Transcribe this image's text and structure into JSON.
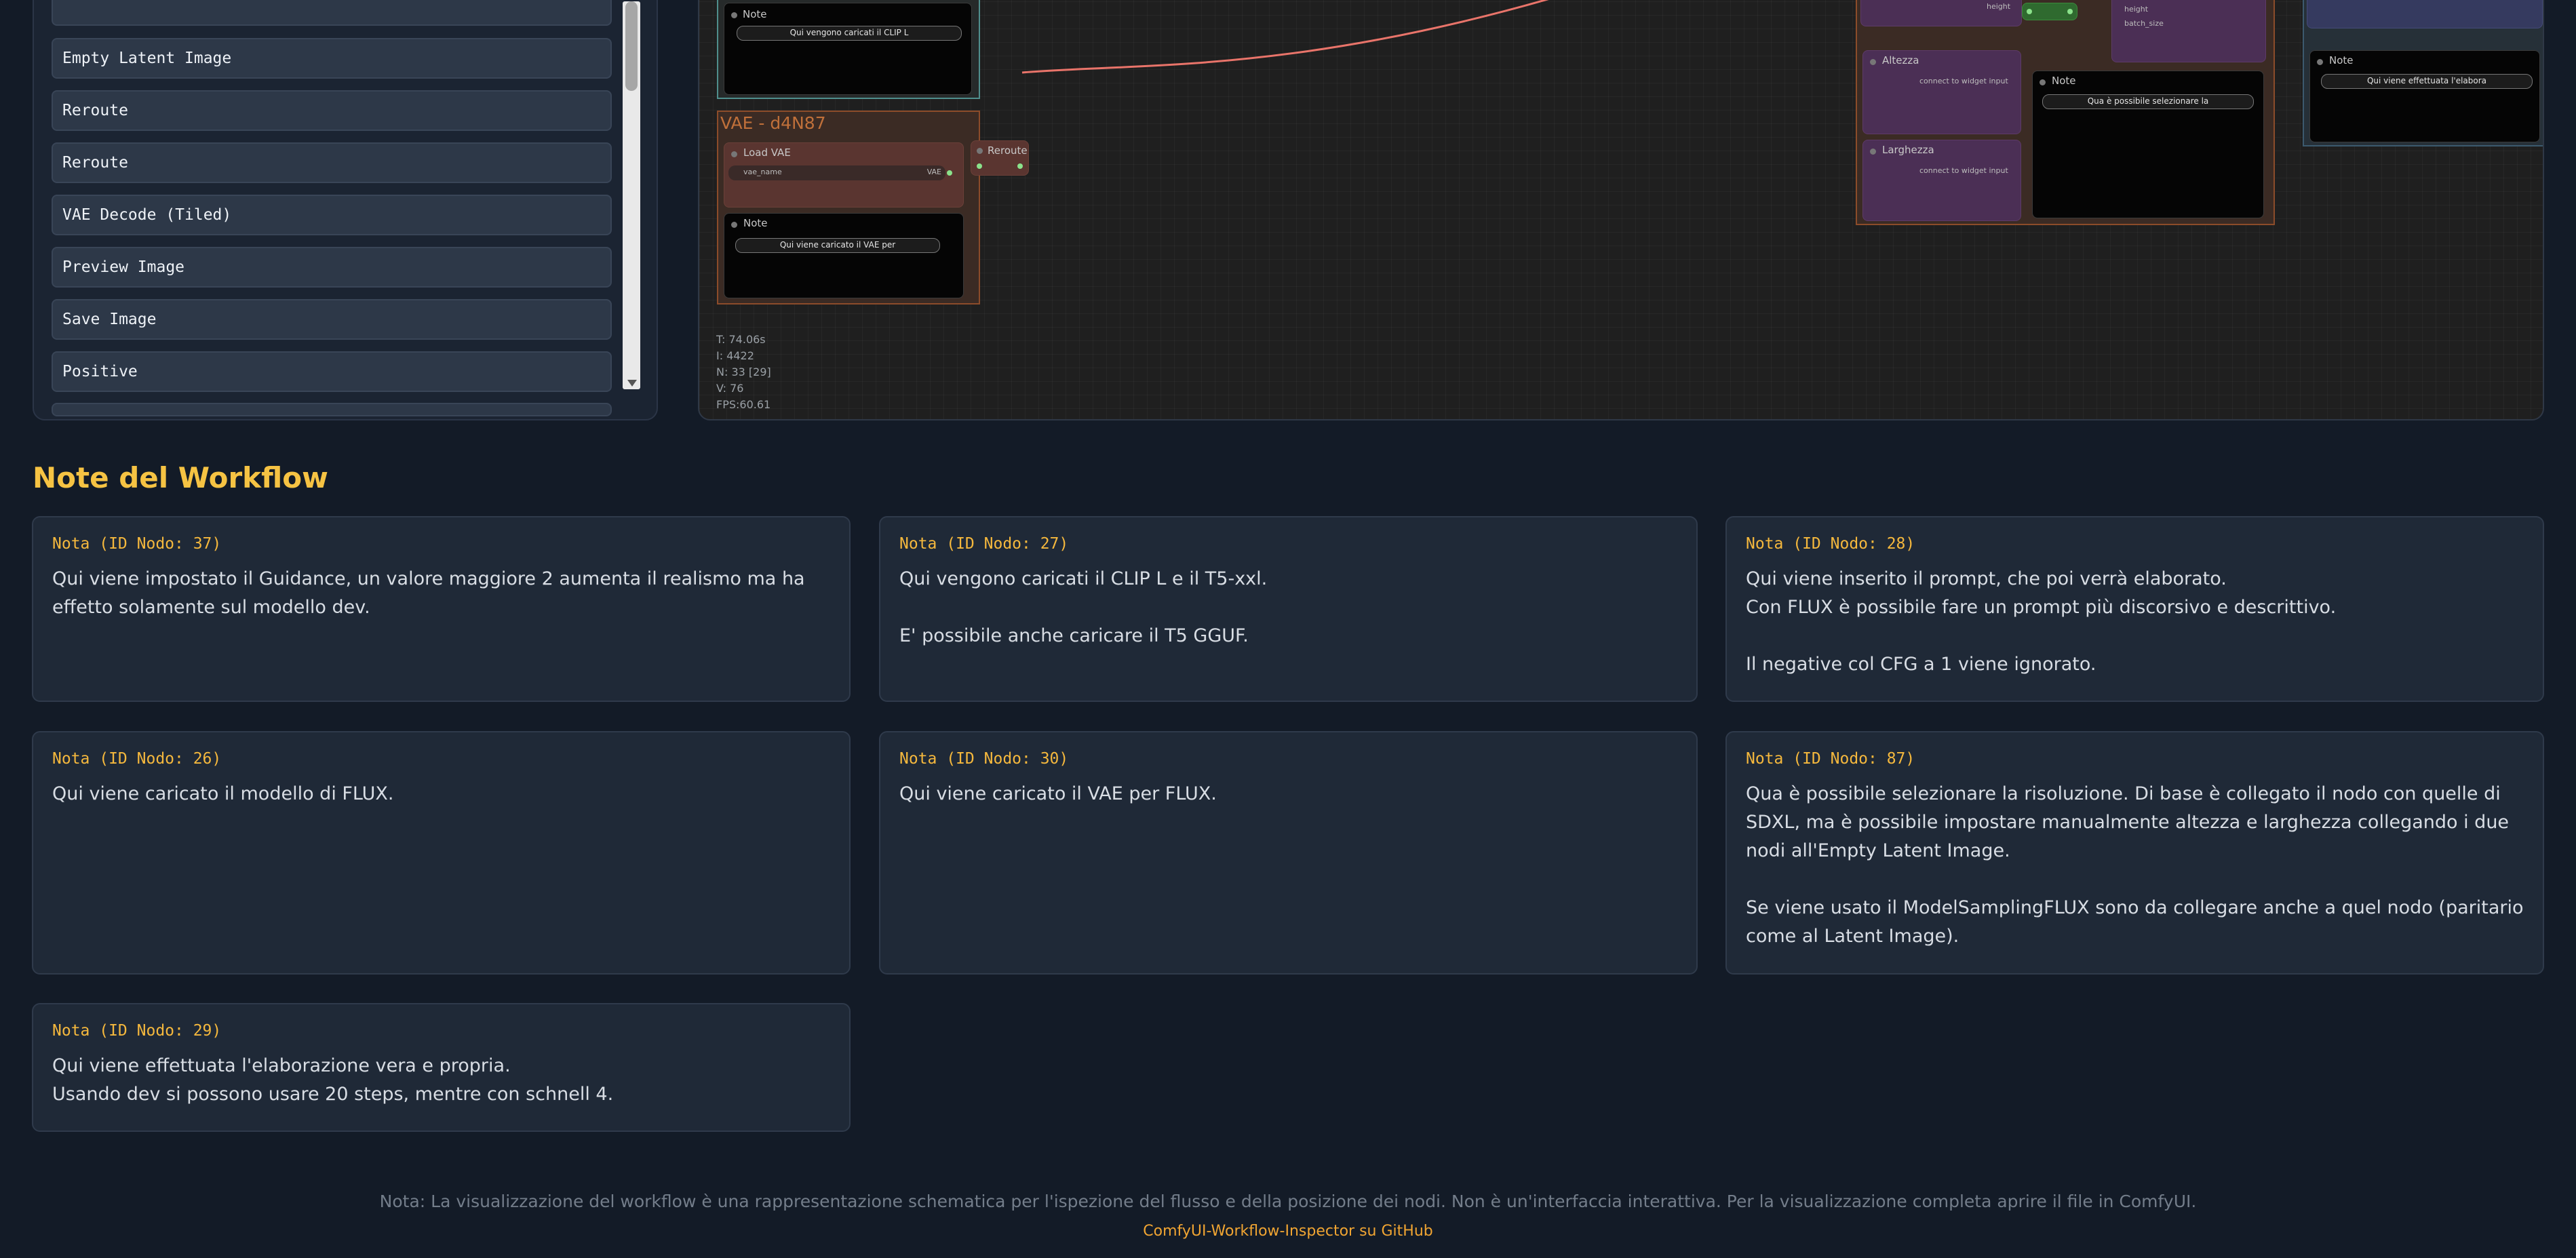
{
  "node_list": {
    "items": [
      "Empty Latent Image",
      "Reroute",
      "Reroute",
      "VAE Decode (Tiled)",
      "Preview Image",
      "Save Image",
      "Positive"
    ]
  },
  "canvas": {
    "vae_group_title": "VAE - d4N87",
    "load_vae_title": "Load VAE",
    "vae_name_label": "vae_name",
    "vae_output_label": "VAE",
    "reroute_title": "Reroute",
    "note_title": "Note",
    "note_clip_preview": "Qui vengono caricati il CLIP L",
    "note_vae_preview": "Qui viene caricato il VAE per",
    "altezza_title": "Altezza",
    "larghezza_title": "Larghezza",
    "connect_widget_label": "connect to widget input",
    "resolution_note_preview": "Qua è possibile selezionare la",
    "right_note_preview": "Qui viene effettuata l'elabora",
    "height_label": "height",
    "batch_size_label": "batch_size",
    "stats": {
      "t": "T: 74.06s",
      "i": "I: 4422",
      "n": "N: 33 [29]",
      "v": "V: 76",
      "fps": "FPS:60.61"
    },
    "colors": {
      "link": "#e9746a",
      "vae_group": "#8c4c2a",
      "purple_node": "#4b2f55",
      "blue_group": "#353a5f"
    }
  },
  "notes": {
    "heading": "Note del Workflow",
    "cards": [
      {
        "id": "Nota (ID Nodo: 37)",
        "text": "Qui viene impostato il Guidance, un valore maggiore 2 aumenta il realismo ma ha effetto solamente sul modello dev."
      },
      {
        "id": "Nota (ID Nodo: 27)",
        "text": "Qui vengono caricati il CLIP L e il T5-xxl.\n\nE' possibile anche caricare il T5 GGUF."
      },
      {
        "id": "Nota (ID Nodo: 28)",
        "text": "Qui viene inserito il prompt, che poi verrà elaborato.\nCon FLUX è possibile fare un prompt più discorsivo e descrittivo.\n\nIl negative col CFG a 1 viene ignorato."
      },
      {
        "id": "Nota (ID Nodo: 26)",
        "text": "Qui viene caricato il modello di FLUX."
      },
      {
        "id": "Nota (ID Nodo: 30)",
        "text": "Qui viene caricato il VAE per FLUX."
      },
      {
        "id": "Nota (ID Nodo: 87)",
        "text": "Qua è possibile selezionare la risoluzione. Di base è collegato il nodo con quelle di SDXL, ma è possibile impostare manualmente altezza e larghezza collegando i due nodi all'Empty Latent Image.\n\nSe viene usato il ModelSamplingFLUX sono da collegare anche a quel nodo (paritario come al Latent Image)."
      },
      {
        "id": "Nota (ID Nodo: 29)",
        "text": "Qui viene effettuata l'elaborazione vera e propria.\nUsando dev si possono usare 20 steps, mentre con schnell 4."
      }
    ]
  },
  "footer": {
    "text": "Nota: La visualizzazione del workflow è una rappresentazione schematica per l'ispezione del flusso e della posizione dei nodi. Non è un'interfaccia interattiva. Per la visualizzazione completa aprire il file in ComfyUI.",
    "link_label": "ComfyUI-Workflow-Inspector su GitHub"
  }
}
